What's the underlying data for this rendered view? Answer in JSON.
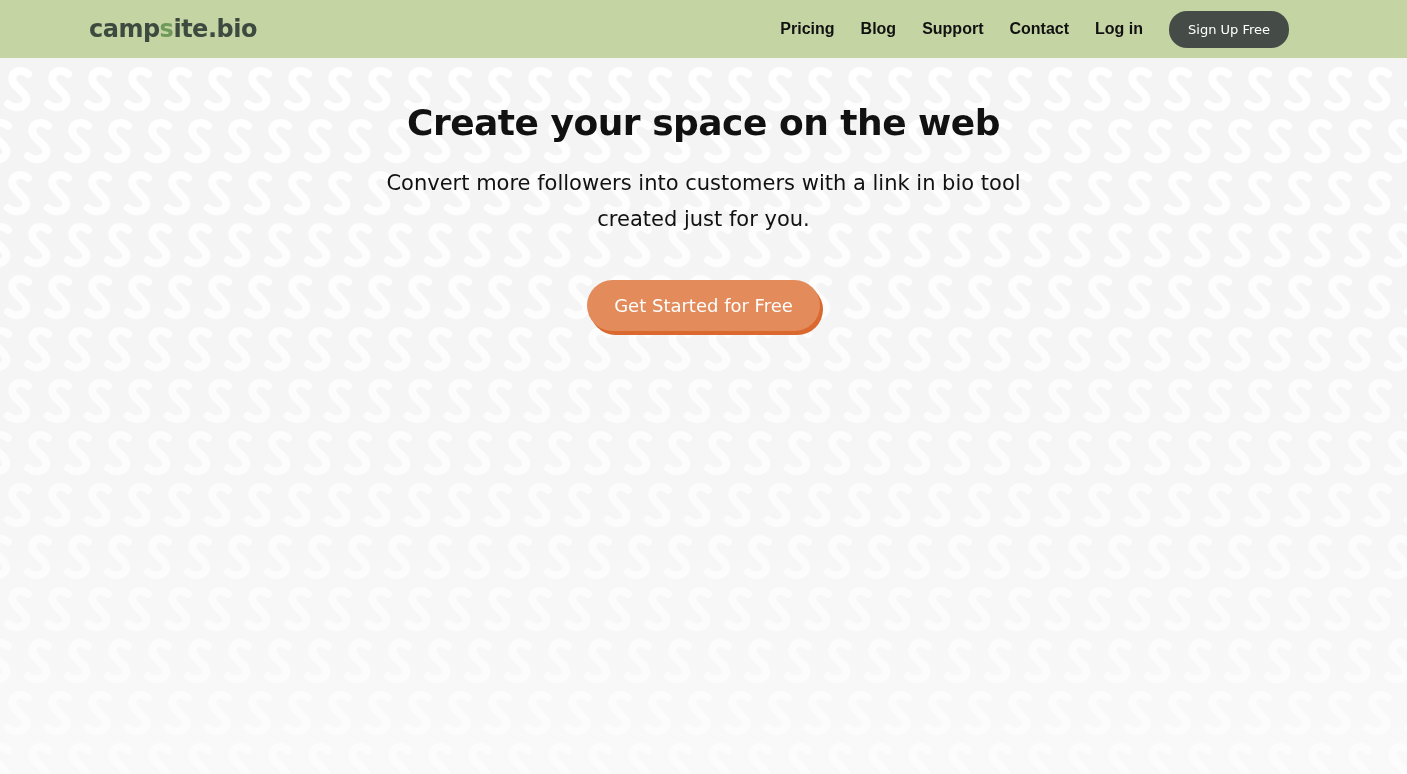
{
  "header": {
    "logo": {
      "prefix": "camp",
      "accent": "s",
      "suffix": "ite.bio"
    },
    "nav": [
      {
        "label": "Pricing"
      },
      {
        "label": "Blog"
      },
      {
        "label": "Support"
      },
      {
        "label": "Contact"
      },
      {
        "label": "Log in"
      }
    ],
    "cta": "Sign Up Free"
  },
  "hero": {
    "title": "Create your space on the web",
    "subtitle": "Convert more followers into customers with a link in bio tool created just for you.",
    "button": "Get Started for Free"
  }
}
